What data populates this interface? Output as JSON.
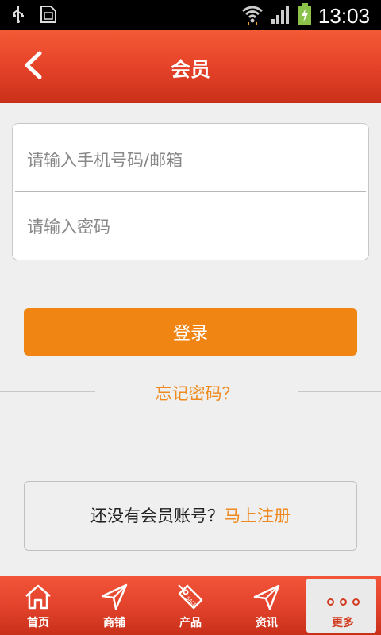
{
  "status_bar": {
    "time": "13:03",
    "left_icons": [
      "usb-icon",
      "sim-icon"
    ],
    "right_icons": [
      "wifi-icon",
      "signal-icon",
      "battery-charging-icon"
    ]
  },
  "header": {
    "title": "会员",
    "back_icon": "chevron-left-icon"
  },
  "login_form": {
    "phone_placeholder": "请输入手机号码/邮箱",
    "phone_value": "",
    "password_placeholder": "请输入密码",
    "password_value": ""
  },
  "login_button": "登录",
  "forgot_password": "忘记密码？",
  "register": {
    "prompt": "还没有会员账号？",
    "link": "马上注册"
  },
  "bottom_nav": {
    "items": [
      {
        "label": "首页",
        "icon": "home-icon",
        "active": false
      },
      {
        "label": "商铺",
        "icon": "navigation-icon",
        "active": false
      },
      {
        "label": "产品",
        "icon": "sale-tag-icon",
        "active": false
      },
      {
        "label": "资讯",
        "icon": "send-icon",
        "active": false
      },
      {
        "label": "更多",
        "icon": "more-dots-icon",
        "active": true
      }
    ]
  },
  "colors": {
    "header_red": "#e8452a",
    "accent_orange": "#f08513",
    "link_orange": "#ee8a1f",
    "background": "#efefef"
  }
}
